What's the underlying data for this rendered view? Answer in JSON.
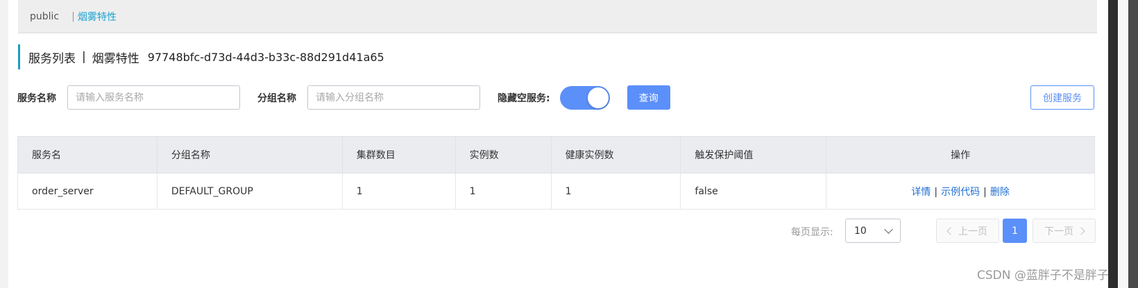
{
  "namespaces": {
    "items": [
      "public",
      "烟雾特性"
    ],
    "separator": "|",
    "active": "烟雾特性"
  },
  "title": {
    "main": "服务列表",
    "separator": "|",
    "namespace": "烟雾特性",
    "namespace_id": "97748bfc-d73d-44d3-b33c-88d291d41a65"
  },
  "filters": {
    "service_label": "服务名称",
    "service_placeholder": "请输入服务名称",
    "group_label": "分组名称",
    "group_placeholder": "请输入分组名称",
    "hide_empty_label": "隐藏空服务:",
    "hide_empty_on": true,
    "query_button": "查询",
    "create_button": "创建服务"
  },
  "table": {
    "headers": [
      "服务名",
      "分组名称",
      "集群数目",
      "实例数",
      "健康实例数",
      "触发保护阈值",
      "操作"
    ],
    "rows": [
      {
        "service": "order_server",
        "group": "DEFAULT_GROUP",
        "clusters": "1",
        "instances": "1",
        "healthy": "1",
        "threshold": "false",
        "ops": [
          "详情",
          "示例代码",
          "删除"
        ]
      }
    ],
    "ops_separator": "|"
  },
  "pagination": {
    "page_size_label": "每页显示:",
    "page_size": "10",
    "prev": "上一页",
    "current": "1",
    "next": "下一页"
  },
  "watermark": "CSDN @蓝胖子不是胖子",
  "colors": {
    "accent": "#5b8ff9",
    "namespace_active": "#1aa3d1",
    "link": "#1f6fd1"
  }
}
